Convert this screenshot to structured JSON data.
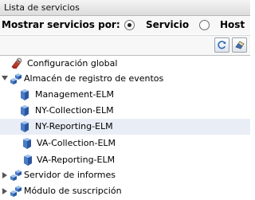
{
  "panel": {
    "title": "Lista de servicios"
  },
  "options": {
    "show_label": "Mostrar servicios por:",
    "radio_service": "Servicio",
    "radio_host": "Host",
    "selected": "Servicio"
  },
  "toolbar": {
    "refresh_icon": "refresh-icon",
    "clear_icon": "eraser-icon"
  },
  "tree": {
    "global_config": "Configuración global",
    "event_store": "Almacén de registro de eventos",
    "elms": [
      "Management-ELM",
      "NY-Collection-ELM",
      "NY-Reporting-ELM",
      "VA-Collection-ELM",
      "VA-Reporting-ELM"
    ],
    "selected_item": "NY-Reporting-ELM",
    "report_server": "Servidor de informes",
    "subscription_module": "Módulo de suscripción"
  },
  "colors": {
    "selection": "#e9eef6",
    "server_icon_blue": "#4a7cc7",
    "config_icon_red": "#c0392b"
  }
}
